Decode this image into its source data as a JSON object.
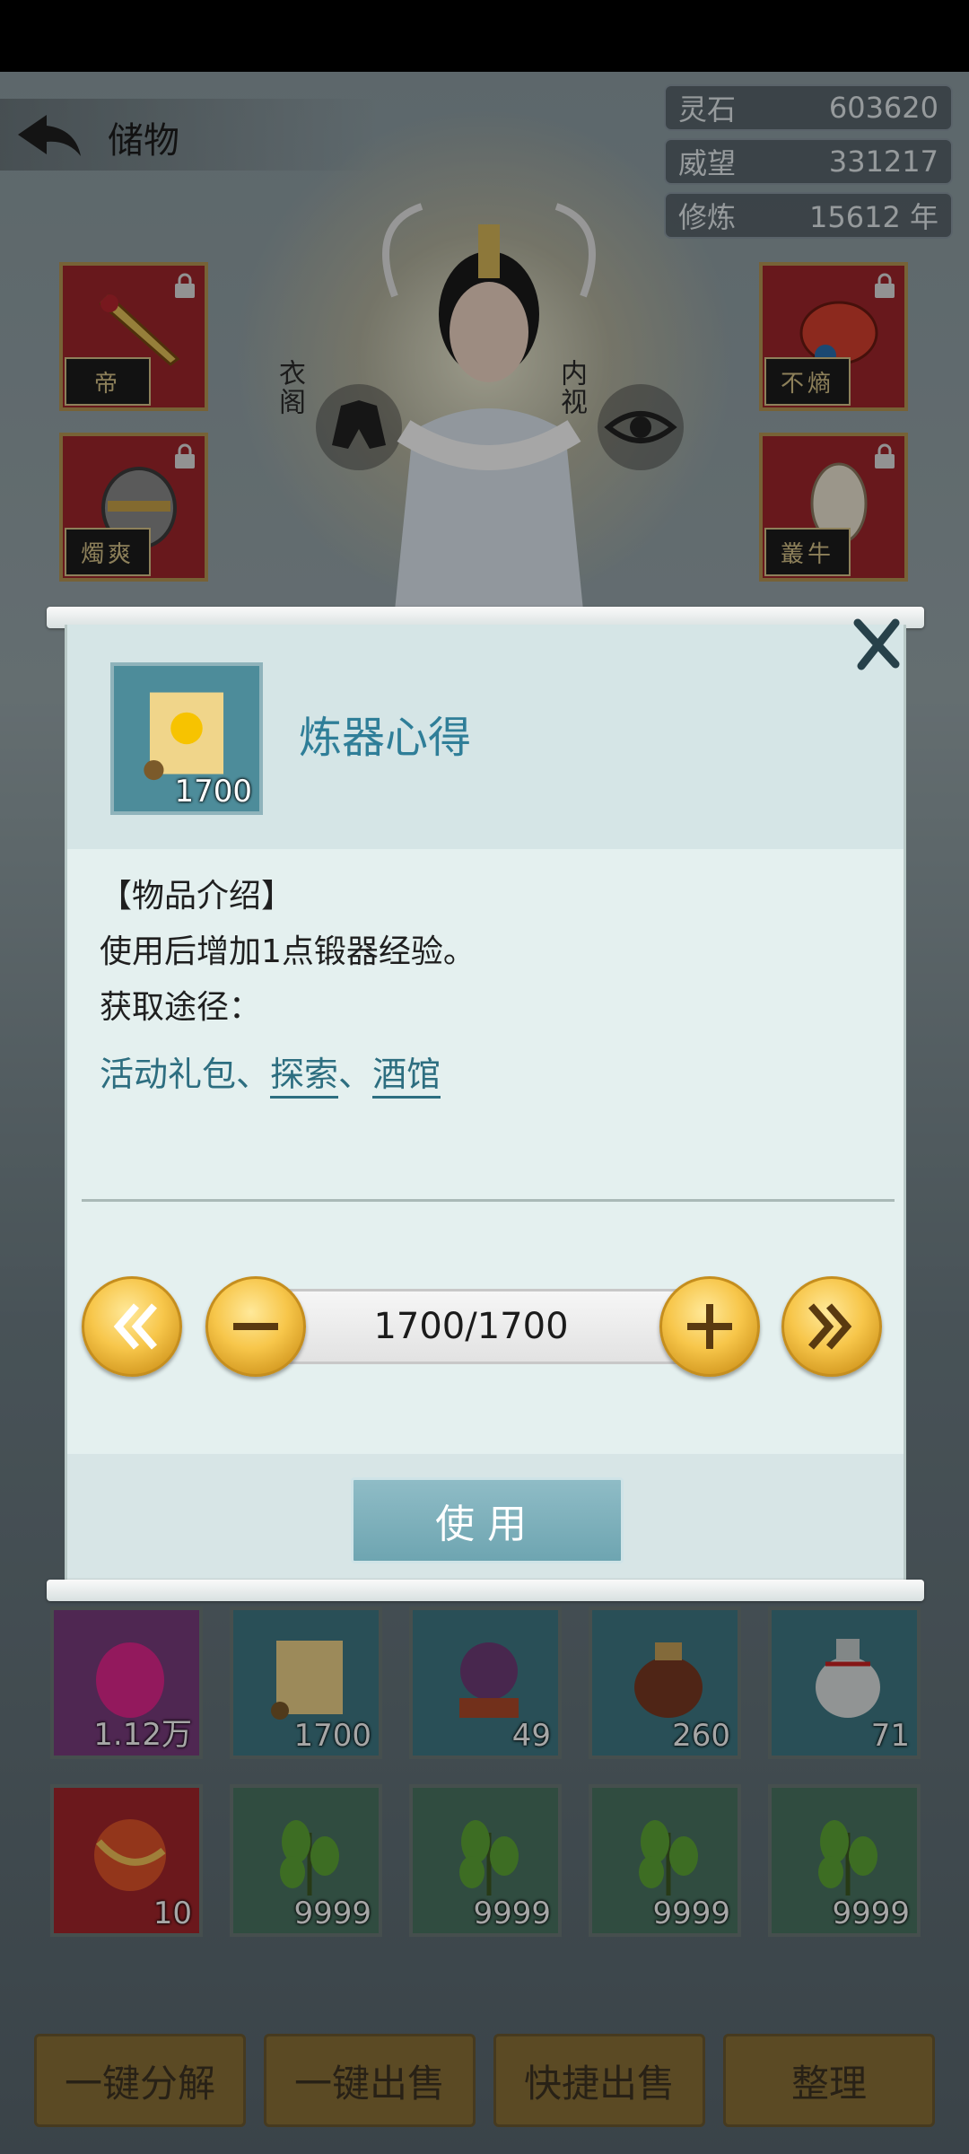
{
  "header": {
    "title": "储物"
  },
  "stats": [
    {
      "label": "灵石",
      "value": "603620"
    },
    {
      "label": "威望",
      "value": "331217"
    },
    {
      "label": "修炼",
      "value": "15612 年"
    }
  ],
  "equipment": {
    "left_top_seal": "帝",
    "left_mid_seal": "燭爽",
    "right_top_seal": "不熵",
    "right_mid_seal": "叢牛"
  },
  "side_buttons": {
    "left_label": "衣阁",
    "right_label": "内视"
  },
  "inventory": [
    {
      "count": "1.12万",
      "icon": "gem-icon"
    },
    {
      "count": "1700",
      "icon": "scroll-icon"
    },
    {
      "count": "49",
      "icon": "crystal-ball-icon"
    },
    {
      "count": "260",
      "icon": "jar-icon"
    },
    {
      "count": "71",
      "icon": "bottle-icon"
    },
    {
      "count": "10",
      "icon": "orb-icon"
    },
    {
      "count": "9999",
      "icon": "herb-icon"
    },
    {
      "count": "9999",
      "icon": "herb-icon"
    },
    {
      "count": "9999",
      "icon": "herb-icon"
    },
    {
      "count": "9999",
      "icon": "herb-icon"
    }
  ],
  "bottom_bar": {
    "decompose": "一键分解",
    "sell_all": "一键出售",
    "quick_sell": "快捷出售",
    "sort": "整理"
  },
  "modal": {
    "item_name": "炼器心得",
    "item_count": "1700",
    "intro_heading": "【物品介绍】",
    "description": "使用后增加1点锻器经验。",
    "source_heading": "获取途径：",
    "source_1": "活动礼包",
    "sep_1": "、",
    "source_2": "探索",
    "sep_2": "、",
    "source_3": "酒馆",
    "quantity": "1700/1700",
    "use_label": "使用"
  }
}
